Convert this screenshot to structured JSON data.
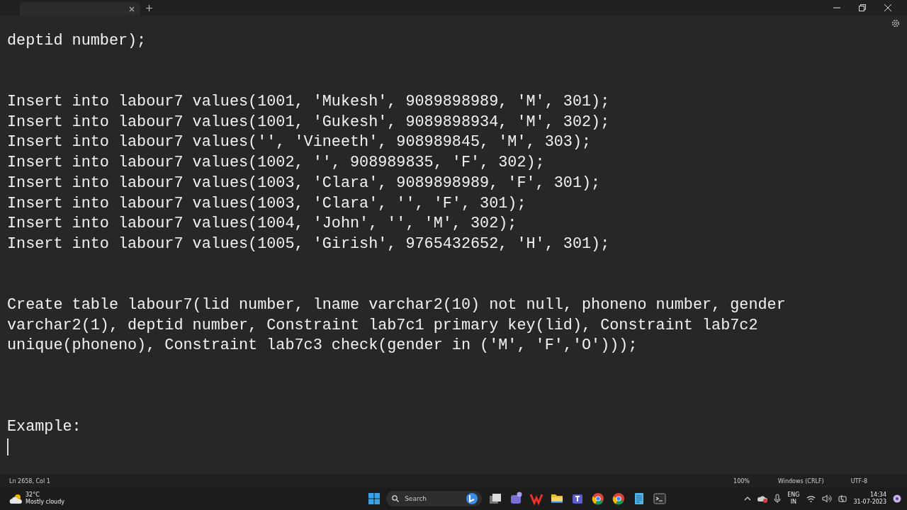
{
  "editor": {
    "lines": [
      {
        "kind": "text",
        "text": "deptid number);"
      },
      {
        "kind": "blank"
      },
      {
        "kind": "blank"
      },
      {
        "kind": "text",
        "text": "Insert into labour7 values(1001, 'Mukesh', 9089898989, 'M', 301);"
      },
      {
        "kind": "text",
        "text": "Insert into labour7 values(1001, 'Gukesh', 9089898934, 'M', 302);"
      },
      {
        "kind": "text",
        "text": "Insert into labour7 values('', 'Vineeth', 908989845, 'M', 303);"
      },
      {
        "kind": "text",
        "text": "Insert into labour7 values(1002, '', 908989835, 'F', 302);"
      },
      {
        "kind": "text",
        "text": "Insert into labour7 values(1003, 'Clara', 9089898989, 'F', 301);"
      },
      {
        "kind": "text",
        "text": "Insert into labour7 values(1003, 'Clara', '', 'F', 301);"
      },
      {
        "kind": "text",
        "text": "Insert into labour7 values(1004, 'John', '', 'M', 302);"
      },
      {
        "kind": "text",
        "text": "Insert into labour7 values(1005, 'Girish', 9765432652, 'H', 301);"
      },
      {
        "kind": "blank"
      },
      {
        "kind": "blank"
      },
      {
        "kind": "text",
        "text": "Create table labour7(lid number, lname varchar2(10) not null, phoneno number, gender"
      },
      {
        "kind": "text",
        "text": "varchar2(1), deptid number, Constraint lab7c1 primary key(lid), Constraint lab7c2"
      },
      {
        "kind": "text",
        "text": "unique(phoneno), Constraint lab7c3 check(gender in ('M', 'F','O')));"
      },
      {
        "kind": "blank"
      },
      {
        "kind": "blank"
      },
      {
        "kind": "blank"
      },
      {
        "kind": "text",
        "text": "Example:"
      },
      {
        "kind": "caret"
      }
    ]
  },
  "status_bar": {
    "position": "Ln 2658, Col 1",
    "zoom": "100%",
    "line_ending": "Windows (CRLF)",
    "encoding": "UTF-8"
  },
  "taskbar": {
    "weather": {
      "temperature": "32°C",
      "condition": "Mostly cloudy"
    },
    "search": {
      "placeholder": "Search"
    },
    "apps": [
      {
        "kind": "copilot"
      },
      {
        "kind": "taskview"
      },
      {
        "kind": "chat"
      },
      {
        "kind": "office"
      },
      {
        "kind": "folder"
      },
      {
        "kind": "teams"
      },
      {
        "kind": "browser"
      },
      {
        "kind": "browser"
      },
      {
        "kind": "notepad"
      },
      {
        "kind": "terminal"
      }
    ],
    "language": [
      "ENG",
      "IN"
    ],
    "time": "14:34",
    "date": "31-07-2023"
  }
}
